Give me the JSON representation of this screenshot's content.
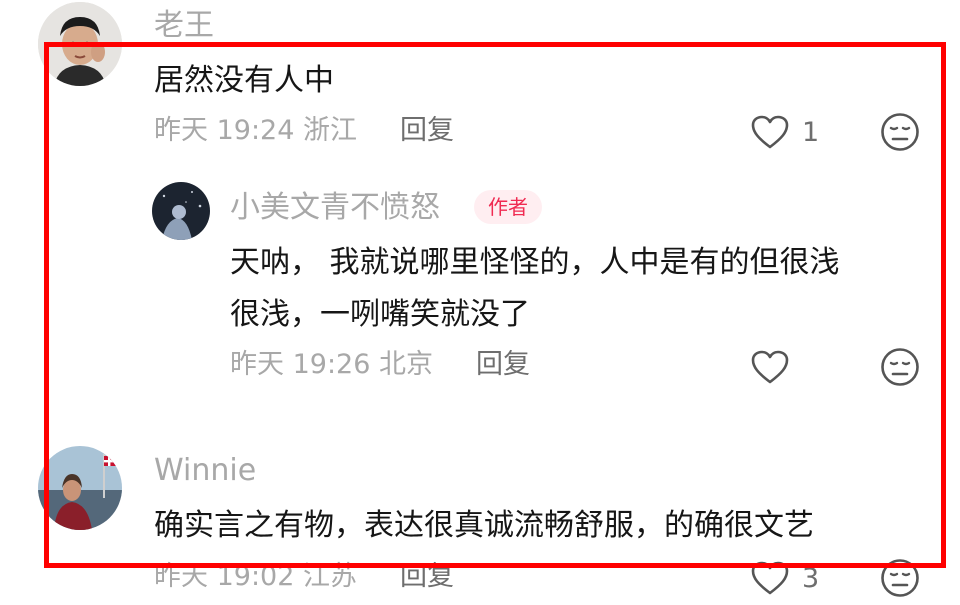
{
  "comments": [
    {
      "username": "老王",
      "text": "居然没有人中",
      "time": "昨天 19:24",
      "location": "浙江",
      "reply_label": "回复",
      "likes": "1",
      "replies": [
        {
          "username": "小美文青不愤怒",
          "badge": "作者",
          "text_line1": "天呐， 我就说哪里怪怪的，人中是有的但很浅",
          "text_line2": "很浅，一咧嘴笑就没了",
          "time": "昨天 19:26",
          "location": "北京",
          "reply_label": "回复"
        }
      ]
    },
    {
      "username": "Winnie",
      "text": "确实言之有物，表达很真诚流畅舒服，的确很文艺",
      "time": "昨天 19:02",
      "location": "江苏",
      "reply_label": "回复",
      "likes": "3"
    }
  ],
  "colors": {
    "highlight_border": "#ff0000",
    "author_badge_bg": "#ffeef1",
    "author_badge_text": "#f02b52",
    "secondary_text": "#a8a8a8"
  },
  "icons": [
    "heart-outline-icon",
    "meh-face-icon"
  ]
}
